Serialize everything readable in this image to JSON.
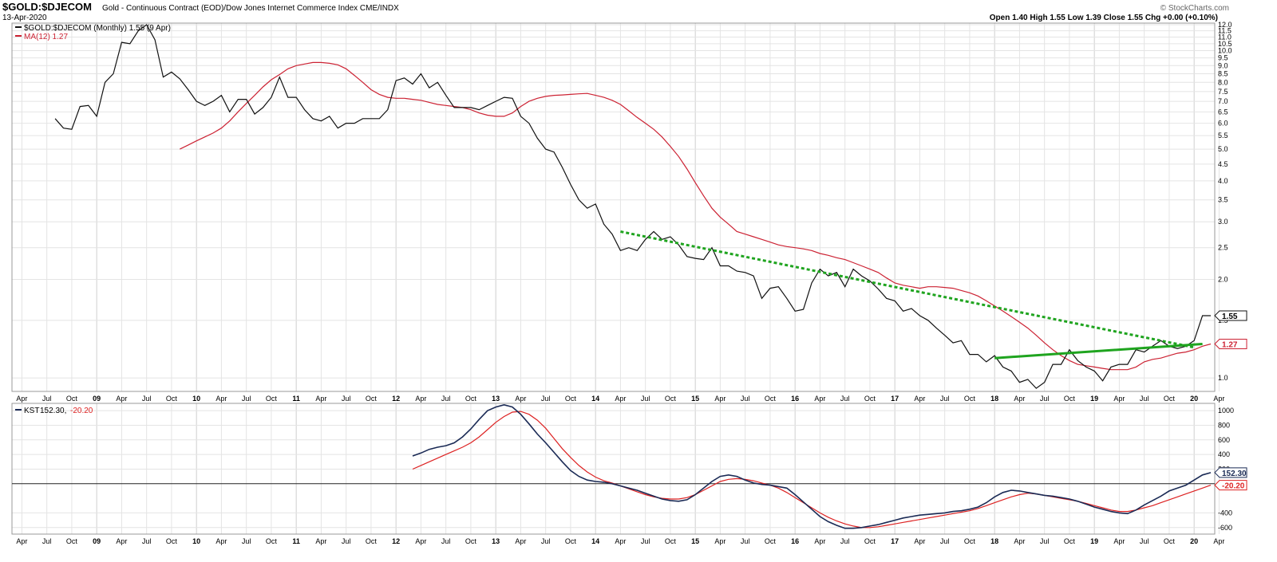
{
  "header": {
    "symbol": "$GOLD:$DJECOM",
    "description": "Gold - Continuous Contract (EOD)/Dow Jones Internet Commerce Index  CME/INDX",
    "date": "13-Apr-2020",
    "ohlc": "Open 1.40  High 1.55  Low 1.39  Close 1.55  Chg +0.00 (+0.10%)",
    "watermark": "© StockCharts.com"
  },
  "legend": {
    "main": "$GOLD:$DJECOM (Monthly) 1.55 (9 Apr)",
    "ma": "MA(12) 1.27",
    "kst_label": "KST",
    "kst_value": "152.30,",
    "kst_signal_value": "-20.20"
  },
  "colors": {
    "price": "#111111",
    "ma": "#cc2233",
    "kst": "#1a2a55",
    "kst_signal": "#dd2222",
    "trendline": "#1fa41f",
    "frame": "#999999"
  },
  "chart_data": [
    {
      "type": "line",
      "scale": "log",
      "ylim": [
        0.92,
        12.0
      ],
      "y_ticks": [
        12.0,
        11.5,
        11.0,
        10.5,
        10.0,
        9.5,
        9.0,
        8.5,
        8.0,
        7.5,
        7.0,
        6.5,
        6.0,
        5.5,
        5.0,
        4.5,
        4.0,
        3.5,
        3.0,
        2.5,
        2.0,
        1.5,
        1.0
      ],
      "x_ticks": [
        "Apr",
        "Jul",
        "Oct",
        "09",
        "Apr",
        "Jul",
        "Oct",
        "10",
        "Apr",
        "Jul",
        "Oct",
        "11",
        "Apr",
        "Jul",
        "Oct",
        "12",
        "Apr",
        "Jul",
        "Oct",
        "13",
        "Apr",
        "Jul",
        "Oct",
        "14",
        "Apr",
        "Jul",
        "Oct",
        "15",
        "Apr",
        "Jul",
        "Oct",
        "16",
        "Apr",
        "Jul",
        "Oct",
        "17",
        "Apr",
        "Jul",
        "Oct",
        "18",
        "Apr",
        "Jul",
        "Oct",
        "19",
        "Apr",
        "Jul",
        "Oct",
        "20",
        "Apr"
      ],
      "last_value_label": "1.55",
      "ma_value_label": "1.27",
      "series": [
        {
          "name": "$GOLD:$DJECOM (Monthly)",
          "values": [
            6.2,
            5.8,
            5.75,
            6.75,
            6.8,
            6.3,
            8.0,
            8.5,
            10.6,
            10.5,
            11.5,
            12.0,
            10.8,
            8.3,
            8.6,
            8.2,
            7.6,
            7.0,
            6.8,
            7.0,
            7.3,
            6.5,
            7.1,
            7.1,
            6.4,
            6.7,
            7.2,
            8.3,
            7.2,
            7.2,
            6.6,
            6.2,
            6.1,
            6.3,
            5.8,
            6.0,
            6.0,
            6.2,
            6.2,
            6.2,
            6.6,
            8.1,
            8.25,
            7.9,
            8.5,
            7.7,
            8.0,
            7.3,
            6.7,
            6.7,
            6.7,
            6.6,
            6.8,
            7.0,
            7.2,
            7.15,
            6.3,
            6.0,
            5.4,
            5.0,
            4.9,
            4.4,
            3.9,
            3.5,
            3.3,
            3.4,
            2.95,
            2.75,
            2.45,
            2.5,
            2.45,
            2.65,
            2.8,
            2.65,
            2.7,
            2.55,
            2.35,
            2.32,
            2.3,
            2.5,
            2.2,
            2.2,
            2.12,
            2.1,
            2.05,
            1.75,
            1.88,
            1.9,
            1.75,
            1.6,
            1.62,
            1.95,
            2.15,
            2.05,
            2.1,
            1.9,
            2.15,
            2.05,
            1.98,
            1.87,
            1.75,
            1.72,
            1.6,
            1.63,
            1.55,
            1.5,
            1.42,
            1.35,
            1.28,
            1.3,
            1.18,
            1.18,
            1.12,
            1.17,
            1.08,
            1.05,
            0.97,
            0.99,
            0.93,
            0.97,
            1.1,
            1.1,
            1.22,
            1.13,
            1.08,
            1.05,
            0.98,
            1.08,
            1.1,
            1.1,
            1.22,
            1.2,
            1.25,
            1.3,
            1.25,
            1.23,
            1.25,
            1.3,
            1.55,
            1.55
          ]
        },
        {
          "name": "MA(12)",
          "values": [
            5.0,
            5.15,
            5.3,
            5.45,
            5.6,
            5.8,
            6.1,
            6.5,
            6.9,
            7.3,
            7.75,
            8.15,
            8.45,
            8.8,
            9.0,
            9.1,
            9.2,
            9.2,
            9.15,
            9.05,
            8.8,
            8.4,
            8.0,
            7.6,
            7.35,
            7.2,
            7.15,
            7.15,
            7.1,
            7.05,
            6.95,
            6.85,
            6.8,
            6.75,
            6.7,
            6.6,
            6.45,
            6.35,
            6.3,
            6.3,
            6.45,
            6.75,
            7.0,
            7.15,
            7.25,
            7.3,
            7.32,
            7.35,
            7.38,
            7.4,
            7.3,
            7.2,
            7.05,
            6.85,
            6.55,
            6.25,
            6.0,
            5.75,
            5.45,
            5.1,
            4.75,
            4.35,
            3.95,
            3.6,
            3.3,
            3.1,
            2.95,
            2.8,
            2.75,
            2.7,
            2.65,
            2.6,
            2.55,
            2.52,
            2.5,
            2.48,
            2.45,
            2.4,
            2.37,
            2.33,
            2.3,
            2.25,
            2.2,
            2.15,
            2.1,
            2.02,
            1.95,
            1.92,
            1.9,
            1.88,
            1.9,
            1.9,
            1.89,
            1.88,
            1.85,
            1.82,
            1.78,
            1.72,
            1.66,
            1.6,
            1.54,
            1.48,
            1.42,
            1.35,
            1.28,
            1.22,
            1.17,
            1.13,
            1.1,
            1.09,
            1.08,
            1.07,
            1.06,
            1.06,
            1.06,
            1.08,
            1.12,
            1.14,
            1.15,
            1.17,
            1.19,
            1.2,
            1.22,
            1.25,
            1.27
          ]
        }
      ],
      "trendlines": [
        {
          "style": "dotted",
          "from": {
            "x": "Apr 2014",
            "y": 2.8
          },
          "to": {
            "x": "Jan 2020",
            "y": 1.24
          }
        },
        {
          "style": "solid",
          "from": {
            "x": "Jan 2018",
            "y": 1.15
          },
          "to": {
            "x": "Feb 2020",
            "y": 1.27
          }
        }
      ]
    },
    {
      "type": "line",
      "ylim": [
        -690,
        1100
      ],
      "y_ticks": [
        1000,
        800,
        600,
        400,
        200,
        -400,
        -600
      ],
      "zero_line": 0,
      "x_ticks": [
        "Apr",
        "Jul",
        "Oct",
        "09",
        "Apr",
        "Jul",
        "Oct",
        "10",
        "Apr",
        "Jul",
        "Oct",
        "11",
        "Apr",
        "Jul",
        "Oct",
        "12",
        "Apr",
        "Jul",
        "Oct",
        "13",
        "Apr",
        "Jul",
        "Oct",
        "14",
        "Apr",
        "Jul",
        "Oct",
        "15",
        "Apr",
        "Jul",
        "Oct",
        "16",
        "Apr",
        "Jul",
        "Oct",
        "17",
        "Apr",
        "Jul",
        "Oct",
        "18",
        "Apr",
        "Jul",
        "Oct",
        "19",
        "Apr",
        "Jul",
        "Oct",
        "20",
        "Apr"
      ],
      "value_labels": [
        "152.30",
        "-20.20"
      ],
      "series": [
        {
          "name": "KST",
          "values": [
            380,
            420,
            470,
            500,
            520,
            560,
            640,
            750,
            880,
            1000,
            1050,
            1080,
            1050,
            950,
            820,
            680,
            560,
            430,
            300,
            180,
            100,
            50,
            30,
            20,
            0,
            -30,
            -60,
            -90,
            -130,
            -170,
            -210,
            -230,
            -240,
            -220,
            -150,
            -60,
            30,
            100,
            120,
            100,
            50,
            10,
            -10,
            -20,
            -40,
            -60,
            -150,
            -250,
            -350,
            -450,
            -520,
            -570,
            -610,
            -610,
            -600,
            -580,
            -560,
            -530,
            -500,
            -470,
            -450,
            -430,
            -420,
            -410,
            -400,
            -380,
            -370,
            -350,
            -320,
            -260,
            -180,
            -120,
            -90,
            -100,
            -120,
            -140,
            -160,
            -170,
            -190,
            -210,
            -240,
            -280,
            -320,
            -350,
            -380,
            -400,
            -410,
            -360,
            -290,
            -230,
            -170,
            -100,
            -60,
            -20,
            50,
            120,
            152
          ]
        },
        {
          "name": "KST signal",
          "values": [
            200,
            250,
            300,
            350,
            400,
            450,
            500,
            560,
            640,
            740,
            840,
            920,
            980,
            990,
            950,
            870,
            760,
            620,
            480,
            360,
            250,
            160,
            90,
            40,
            10,
            -30,
            -70,
            -110,
            -150,
            -180,
            -200,
            -210,
            -210,
            -190,
            -150,
            -90,
            -30,
            30,
            60,
            70,
            60,
            40,
            10,
            -20,
            -60,
            -120,
            -190,
            -260,
            -330,
            -400,
            -460,
            -510,
            -550,
            -580,
            -600,
            -600,
            -590,
            -570,
            -550,
            -530,
            -510,
            -490,
            -470,
            -450,
            -430,
            -410,
            -390,
            -370,
            -340,
            -300,
            -260,
            -220,
            -180,
            -150,
            -130,
            -140,
            -160,
            -180,
            -200,
            -220,
            -240,
            -270,
            -300,
            -330,
            -360,
            -380,
            -380,
            -360,
            -330,
            -300,
            -260,
            -220,
            -180,
            -140,
            -100,
            -60,
            -20
          ]
        }
      ]
    }
  ]
}
